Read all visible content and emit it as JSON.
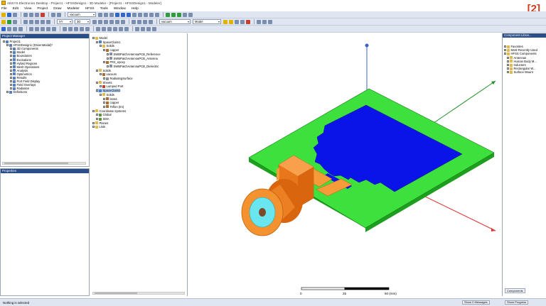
{
  "window": {
    "title": "ANSYS Electronics Desktop - Project1 - HFSSDesign1 - 3D Modeler - [Project1 - HFSSDesign1 - Modeler]",
    "badge": "[2]"
  },
  "menu": [
    "File",
    "Edit",
    "View",
    "Project",
    "Draw",
    "Modeler",
    "HFSS",
    "Tools",
    "Window",
    "Help"
  ],
  "toolbar": {
    "material_select": "vacuum",
    "plane_select": "XY",
    "dim_select": "3D",
    "draw_select": "Model"
  },
  "project_manager": {
    "title": "Project Manager",
    "items": [
      {
        "label": "Project1",
        "depth": 0
      },
      {
        "label": "HFSSDesign1 (DrivenModal)*",
        "depth": 1
      },
      {
        "label": "3D Components",
        "depth": 2
      },
      {
        "label": "Model",
        "depth": 2
      },
      {
        "label": "Boundaries",
        "depth": 2
      },
      {
        "label": "Excitations",
        "depth": 2
      },
      {
        "label": "Hybrid Regions",
        "depth": 2
      },
      {
        "label": "Mesh Operations",
        "depth": 2
      },
      {
        "label": "Analysis",
        "depth": 2
      },
      {
        "label": "Optimetrics",
        "depth": 2
      },
      {
        "label": "Results",
        "depth": 2
      },
      {
        "label": "Port Field Display",
        "depth": 2
      },
      {
        "label": "Field Overlays",
        "depth": 2
      },
      {
        "label": "Radiation",
        "depth": 2
      },
      {
        "label": "Definitions",
        "depth": 1
      }
    ]
  },
  "properties": {
    "title": "Properties"
  },
  "model_tree": {
    "items": [
      {
        "label": "Model",
        "depth": 0,
        "icon": "folder"
      },
      {
        "label": "SpaceClaim1",
        "depth": 1,
        "icon": "part"
      },
      {
        "label": "Solids",
        "depth": 2,
        "icon": "folder"
      },
      {
        "label": "copper",
        "depth": 3,
        "icon": "material"
      },
      {
        "label": "SWBPatchAntennaPCB_Reference",
        "depth": 4,
        "icon": "body"
      },
      {
        "label": "SWBPatchAntennaPCB_Antenna",
        "depth": 4,
        "icon": "body"
      },
      {
        "label": "FR4_epoxy",
        "depth": 3,
        "icon": "material"
      },
      {
        "label": "SWBPatchAntennaPCB_Dielectric",
        "depth": 4,
        "icon": "body"
      },
      {
        "label": "Solids",
        "depth": 1,
        "icon": "folder"
      },
      {
        "label": "vacuum",
        "depth": 2,
        "icon": "material"
      },
      {
        "label": "RadiatingSurface",
        "depth": 3,
        "icon": "body"
      },
      {
        "label": "Sheets",
        "depth": 1,
        "icon": "folder"
      },
      {
        "label": "Lumped Port",
        "depth": 2,
        "icon": "port"
      },
      {
        "label": "SpaceClaim2",
        "depth": 1,
        "icon": "part",
        "selected": true
      },
      {
        "label": "Solids",
        "depth": 2,
        "icon": "folder"
      },
      {
        "label": "brass",
        "depth": 3,
        "icon": "material"
      },
      {
        "label": "copper",
        "depth": 3,
        "icon": "material"
      },
      {
        "label": "Teflon (tm)",
        "depth": 3,
        "icon": "material"
      },
      {
        "label": "Coordinate Systems",
        "depth": 0,
        "icon": "folder"
      },
      {
        "label": "Global",
        "depth": 1,
        "icon": "cs"
      },
      {
        "label": "SMA",
        "depth": 1,
        "icon": "cs"
      },
      {
        "label": "Planes",
        "depth": 0,
        "icon": "folder"
      },
      {
        "label": "Lists",
        "depth": 0,
        "icon": "folder"
      }
    ]
  },
  "scale_bar": {
    "labels": [
      "0",
      "25",
      "50 (mm)"
    ]
  },
  "component_library": {
    "title": "Component Librar...",
    "items": [
      {
        "label": "Favorites",
        "depth": 0
      },
      {
        "label": "Most Recently Used",
        "depth": 0
      },
      {
        "label": "HFSS Components",
        "depth": 0
      },
      {
        "label": "Antennas",
        "depth": 1
      },
      {
        "label": "Human Body M...",
        "depth": 1
      },
      {
        "label": "Inductors",
        "depth": 1
      },
      {
        "label": "Rectangular W...",
        "depth": 1
      },
      {
        "label": "Surface Mount",
        "depth": 1
      }
    ],
    "tab": "Components"
  },
  "status": {
    "text": "Nothing is selected",
    "messages_btn": "Show 0 Messages",
    "progress_btn": "Show Progress"
  },
  "colors": {
    "substrate": "#3de03d",
    "patch": "#0a14e8",
    "connector": "#f07d1e",
    "teflon": "#69e6ef",
    "axis_x": "#e03030",
    "axis_y": "#1f8f2a",
    "axis_z": "#3a64c8"
  }
}
